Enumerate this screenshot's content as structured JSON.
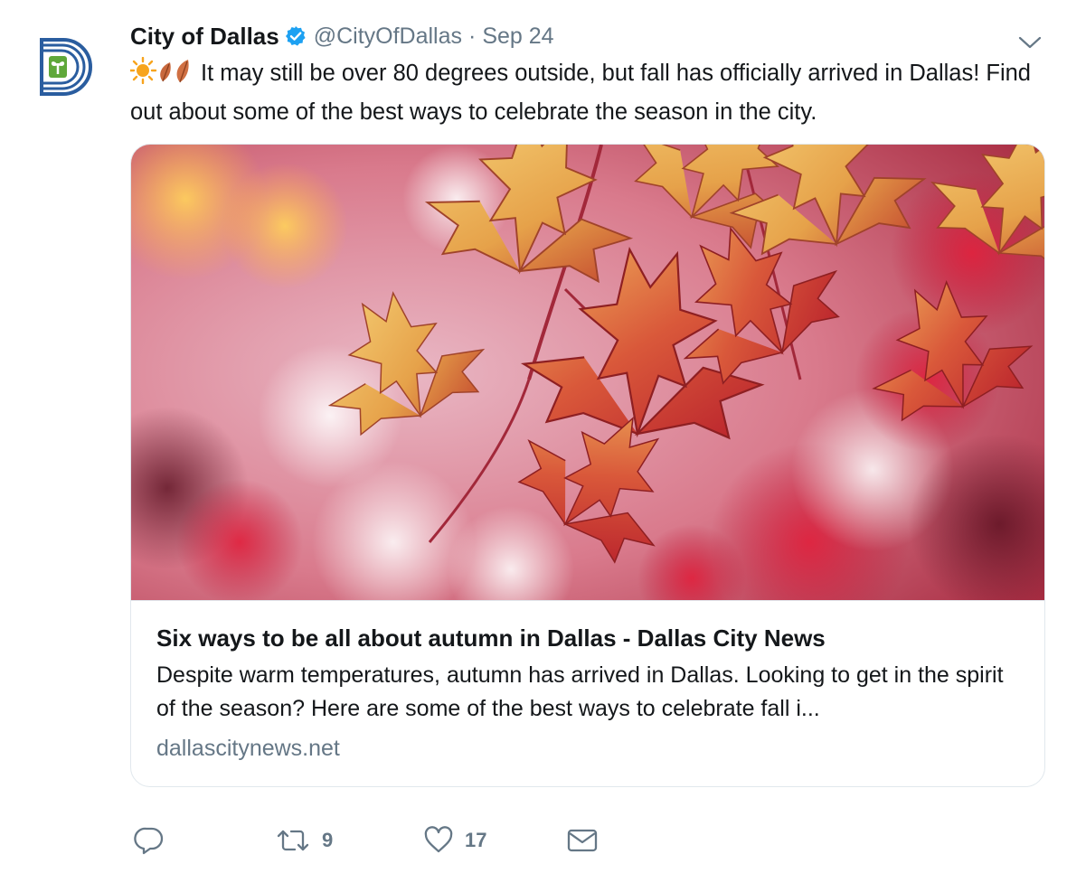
{
  "tweet": {
    "author": {
      "display_name": "City of Dallas",
      "handle": "@CityOfDallas",
      "verified": true,
      "avatar_icon": "city-of-dallas-logo-icon"
    },
    "separator": "·",
    "date": "Sep 24",
    "emojis": [
      "sun-emoji",
      "fallen-leaf-emoji",
      "fallen-leaf-emoji"
    ],
    "text": "It may still be over 80 degrees outside, but fall has officially arrived in Dallas! Find out about some of the best ways to celebrate the season in the city.",
    "card": {
      "image_description_icon": "autumn-maple-leaves-photo",
      "title": "Six ways to be all about autumn in Dallas - Dallas City News",
      "description": "Despite warm temperatures, autumn has arrived in Dallas. Looking to get in the spirit of the season? Here are some of the best ways to celebrate fall i...",
      "domain": "dallascitynews.net"
    },
    "actions": {
      "reply": {
        "icon": "reply-icon",
        "count": ""
      },
      "retweet": {
        "icon": "retweet-icon",
        "count": "9"
      },
      "like": {
        "icon": "heart-icon",
        "count": "17"
      },
      "message": {
        "icon": "envelope-icon",
        "count": ""
      }
    }
  },
  "colors": {
    "text_primary": "#14171a",
    "text_secondary": "#657786",
    "verified_blue": "#1da1f2",
    "border": "#e1e8ed",
    "logo_blue": "#2a5d9f",
    "logo_green": "#5fa83a"
  }
}
